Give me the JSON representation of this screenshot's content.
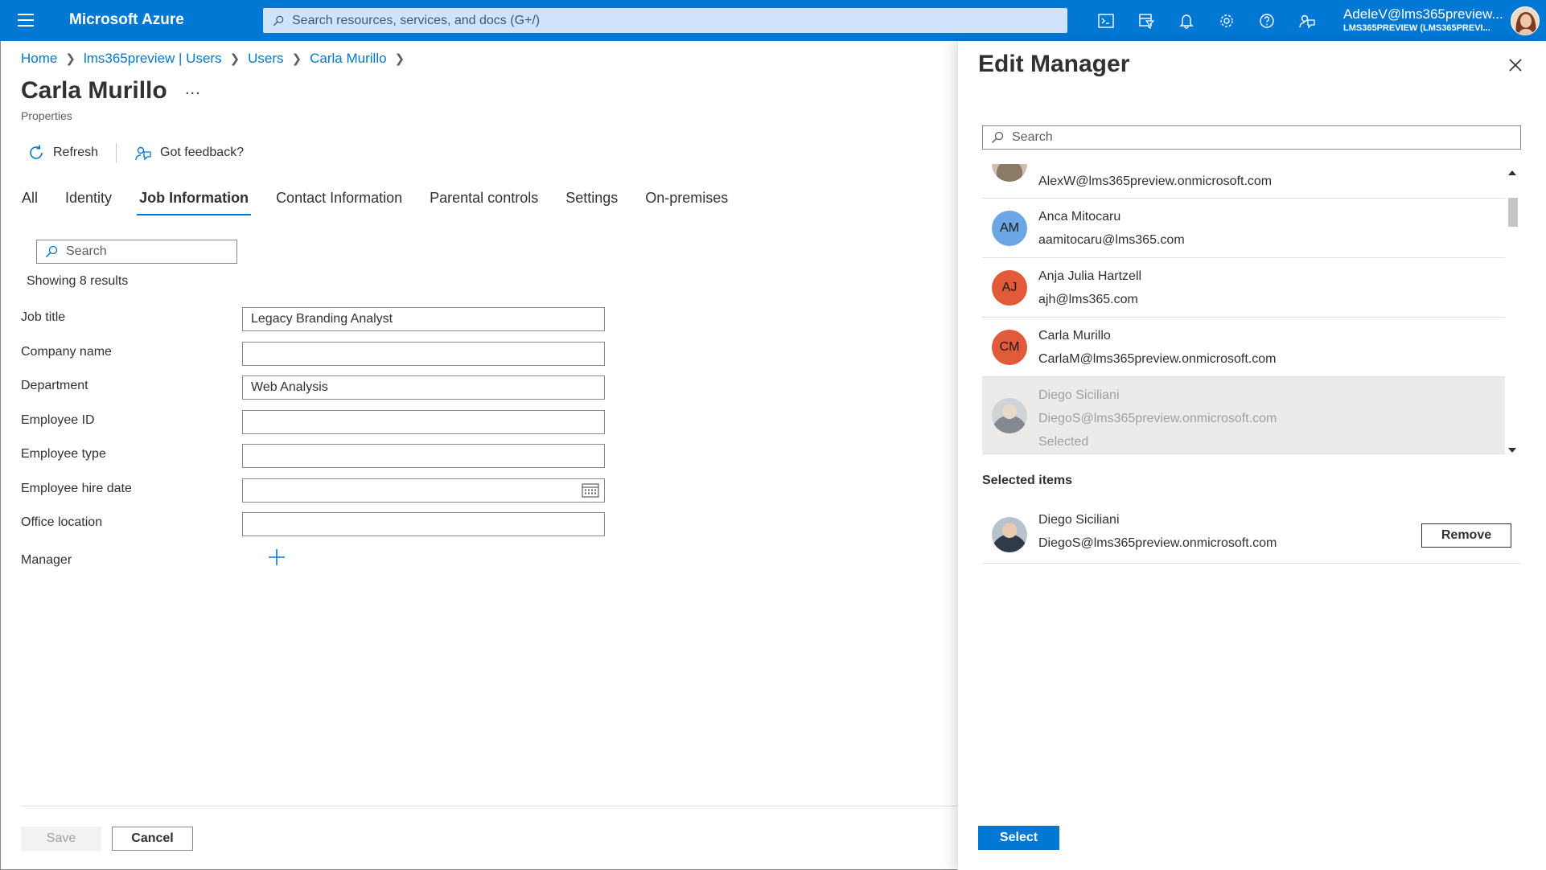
{
  "topbar": {
    "brand": "Microsoft Azure",
    "search_placeholder": "Search resources, services, and docs (G+/)",
    "account_name": "AdeleV@lms365preview...",
    "account_tenant": "LMS365PREVIEW (LMS365PREVI...",
    "icons": [
      "cloud-shell-icon",
      "directory-filter-icon",
      "notifications-icon",
      "settings-icon",
      "help-icon",
      "feedback-icon"
    ]
  },
  "breadcrumb": [
    {
      "label": "Home"
    },
    {
      "label": "lms365preview | Users"
    },
    {
      "label": "Users"
    },
    {
      "label": "Carla Murillo"
    }
  ],
  "page": {
    "title": "Carla Murillo",
    "ellipsis": "...",
    "subtitle": "Properties"
  },
  "commands": {
    "refresh": "Refresh",
    "feedback": "Got feedback?"
  },
  "tabs": [
    {
      "label": "All",
      "active": false
    },
    {
      "label": "Identity",
      "active": false
    },
    {
      "label": "Job Information",
      "active": true
    },
    {
      "label": "Contact Information",
      "active": false
    },
    {
      "label": "Parental controls",
      "active": false
    },
    {
      "label": "Settings",
      "active": false
    },
    {
      "label": "On-premises",
      "active": false
    }
  ],
  "filter": {
    "placeholder": "Search",
    "showing": "Showing 8 results"
  },
  "form": {
    "job_title": {
      "label": "Job title",
      "value": "Legacy Branding Analyst"
    },
    "company_name": {
      "label": "Company name",
      "value": ""
    },
    "department": {
      "label": "Department",
      "value": "Web Analysis"
    },
    "employee_id": {
      "label": "Employee ID",
      "value": ""
    },
    "employee_type": {
      "label": "Employee type",
      "value": ""
    },
    "hire_date": {
      "label": "Employee hire date",
      "value": ""
    },
    "office_location": {
      "label": "Office location",
      "value": ""
    },
    "manager": {
      "label": "Manager"
    }
  },
  "footer": {
    "save": "Save",
    "cancel": "Cancel"
  },
  "panel": {
    "title": "Edit Manager",
    "search_placeholder": "Search",
    "list": [
      {
        "initials": "",
        "name": "",
        "email": "AlexW@lms365preview.onmicrosoft.com",
        "color": "#cdbfae"
      },
      {
        "initials": "AM",
        "name": "Anca Mitocaru",
        "email": "aamitocaru@lms365.com",
        "color": "#6ca6e5"
      },
      {
        "initials": "AJ",
        "name": "Anja Julia Hartzell",
        "email": "ajh@lms365.com",
        "color": "#e15a3a"
      },
      {
        "initials": "CM",
        "name": "Carla Murillo",
        "email": "CarlaM@lms365preview.onmicrosoft.com",
        "color": "#e15a3a"
      },
      {
        "initials": "",
        "name": "Diego Siciliani",
        "email": "DiegoS@lms365preview.onmicrosoft.com",
        "status": "Selected",
        "color": "#b8c2cc"
      }
    ],
    "selected_heading": "Selected items",
    "selected": {
      "name": "Diego Siciliani",
      "email": "DiegoS@lms365preview.onmicrosoft.com",
      "remove": "Remove"
    },
    "select_button": "Select"
  },
  "colors": {
    "accent": "#0078d4",
    "topbar": "#0078d4"
  }
}
